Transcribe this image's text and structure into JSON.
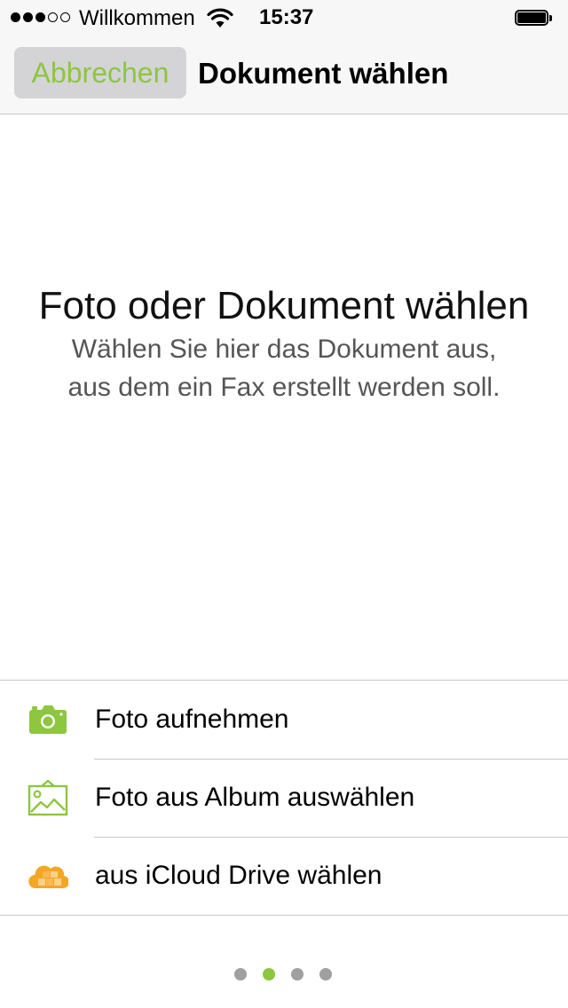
{
  "status_bar": {
    "carrier": "Willkommen",
    "time": "15:37",
    "signal_bars_filled": 3,
    "signal_bars_total": 5
  },
  "nav": {
    "cancel_label": "Abbrechen",
    "title": "Dokument wählen"
  },
  "hero": {
    "title": "Foto oder Dokument wählen",
    "subtitle_line1": "Wählen Sie hier das Dokument aus,",
    "subtitle_line2": "aus dem ein Fax erstellt werden soll."
  },
  "options": [
    {
      "label": "Foto aufnehmen",
      "icon": "camera-icon"
    },
    {
      "label": "Foto aus Album auswählen",
      "icon": "photo-album-icon"
    },
    {
      "label": "aus iCloud Drive wählen",
      "icon": "icloud-drive-icon"
    }
  ],
  "pager": {
    "pages": 4,
    "current_page": 2
  },
  "colors": {
    "accent": "#8dc63f",
    "cloud_orange": "#f5a623",
    "cancel_bg": "#d4d4d6",
    "bar_bg": "#f7f7f7",
    "separator": "#c8c8cc"
  }
}
